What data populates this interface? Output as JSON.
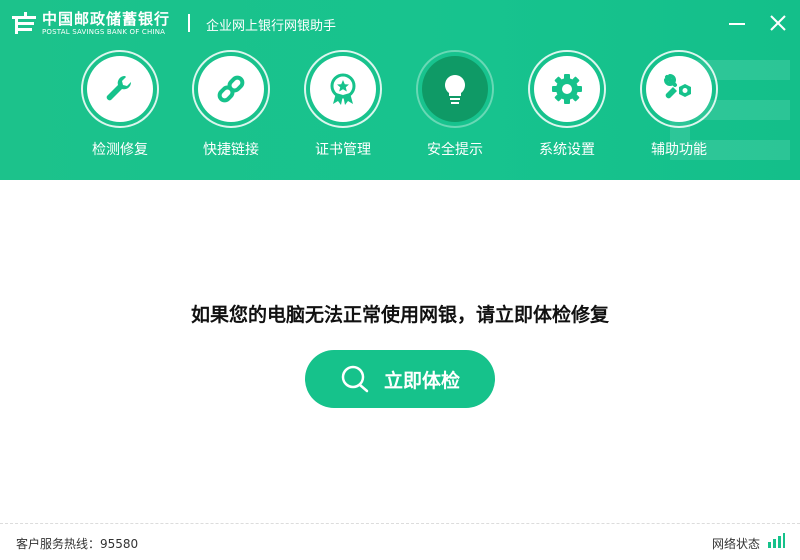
{
  "app": {
    "bank_name_cn": "中国邮政储蓄银行",
    "bank_name_en": "POSTAL SAVINGS BANK OF CHINA",
    "title": "企业网上银行网银助手"
  },
  "window": {
    "minimize_icon": "minus-icon",
    "close_icon": "close-icon"
  },
  "nav": {
    "items": [
      {
        "label": "检测修复",
        "icon": "wrench-icon"
      },
      {
        "label": "快捷链接",
        "icon": "link-icon"
      },
      {
        "label": "证书管理",
        "icon": "certificate-badge-icon"
      },
      {
        "label": "安全提示",
        "icon": "lightbulb-icon",
        "active": true
      },
      {
        "label": "系统设置",
        "icon": "gear-icon"
      },
      {
        "label": "辅助功能",
        "icon": "tools-icon"
      }
    ]
  },
  "main": {
    "headline": "如果您的电脑无法正常使用网银，请立即体检修复",
    "check_button_label": "立即体检"
  },
  "footer": {
    "hotline": "客户服务热线：95580",
    "network_status": "网络状态"
  },
  "colors": {
    "brand_green": "#16c28b",
    "active_nav": "#0f9a66"
  }
}
